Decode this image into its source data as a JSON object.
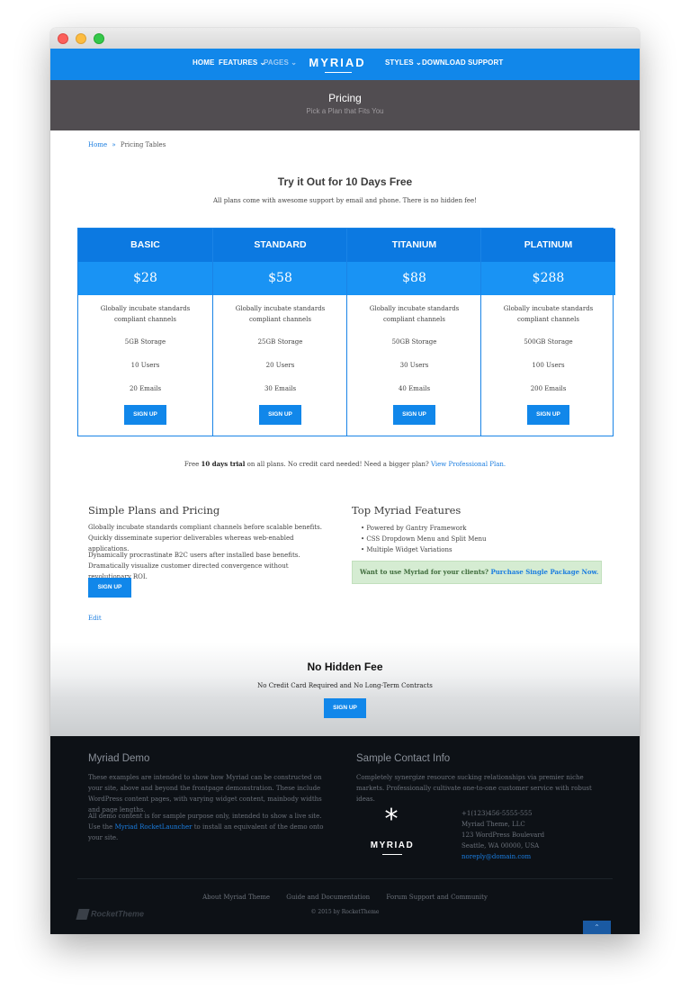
{
  "nav": {
    "items_left": [
      "HOME",
      "FEATURES",
      "PAGES"
    ],
    "items_right": [
      "STYLES",
      "DOWNLOAD",
      "SUPPORT"
    ],
    "logo": "MYRIAD",
    "caret": "⌄"
  },
  "banner": {
    "title": "Pricing",
    "subtitle": "Pick a Plan that Fits You"
  },
  "breadcrumb": {
    "home": "Home",
    "separator": "»",
    "current": "Pricing Tables"
  },
  "trial": {
    "title": "Try it Out for 10 Days Free",
    "subtitle": "All plans come with awesome support by email and phone. There is no hidden fee!"
  },
  "plans": [
    {
      "name": "BASIC",
      "price": "$28",
      "desc": "Globally incubate standards compliant channels",
      "storage": "5GB Storage",
      "users": "10 Users",
      "emails": "20 Emails",
      "button": "SIGN UP"
    },
    {
      "name": "STANDARD",
      "price": "$58",
      "desc": "Globally incubate standards compliant channels",
      "storage": "25GB Storage",
      "users": "20 Users",
      "emails": "30 Emails",
      "button": "SIGN UP"
    },
    {
      "name": "TITANIUM",
      "price": "$88",
      "desc": "Globally incubate standards compliant channels",
      "storage": "50GB Storage",
      "users": "30 Users",
      "emails": "40 Emails",
      "button": "SIGN UP"
    },
    {
      "name": "PLATINUM",
      "price": "$288",
      "desc": "Globally incubate standards compliant channels",
      "storage": "500GB Storage",
      "users": "100 Users",
      "emails": "200 Emails",
      "button": "SIGN UP"
    }
  ],
  "free_note": {
    "prefix": "Free ",
    "bold": "10 days trial",
    "middle": " on all plans. No credit card needed! Need a bigger plan? ",
    "link": "View Professional Plan."
  },
  "simple": {
    "title": "Simple Plans and Pricing",
    "para1": "Globally incubate standards compliant channels before scalable benefits. Quickly disseminate superior deliverables whereas web-enabled applications.",
    "para2": "Dynamically procrastinate B2C users after installed base benefits. Dramatically visualize customer directed convergence without revolutionary ROI.",
    "button": "SIGN UP",
    "edit": "Edit"
  },
  "features": {
    "title": "Top Myriad Features",
    "items": [
      "Powered by Gantry Framework",
      "CSS Dropdown Menu and Split Menu",
      "Multiple Widget Variations"
    ],
    "alert_text": "Want to use Myriad for your clients? ",
    "alert_link": "Purchase Single Package Now."
  },
  "nohidden": {
    "title": "No Hidden Fee",
    "subtitle": "No Credit Card Required and No Long-Term Contracts",
    "button": "SIGN UP"
  },
  "footer": {
    "demo_title": "Myriad Demo",
    "demo_para1": "These examples are intended to show how Myriad can be constructed on your site, above and beyond the frontpage demonstration. These include WordPress content pages, with varying widget content, mainbody widths and page lengths.",
    "demo_para2_a": "All demo content is for sample purpose only, intended to show a live site. Use the ",
    "demo_para2_link": "Myriad RocketLauncher",
    "demo_para2_b": " to install an equivalent of the demo onto your site.",
    "contact_title": "Sample Contact Info",
    "contact_para": "Completely synergize resource sucking relationships via premier niche markets. Professionally cultivate one-to-one customer service with robust ideas.",
    "logo_star": "*",
    "logo_text": "MYRIAD",
    "phone": "+1(123)456-5555-555",
    "company": "Myriad Theme, LLC",
    "street": "123 WordPress Boulevard",
    "city": "Seattle, WA 00000, USA",
    "email": "noreply@domain.com",
    "links": [
      "About Myriad Theme",
      "Guide and Documentation",
      "Forum Support and Community"
    ],
    "copyright": "© 2015 by RocketTheme",
    "brand": "RocketTheme",
    "totop": "⌃"
  },
  "colors": {
    "primary": "#1187ea",
    "banner": "#514d51",
    "footer": "#0d1116",
    "alert": "#d5ecd2"
  }
}
